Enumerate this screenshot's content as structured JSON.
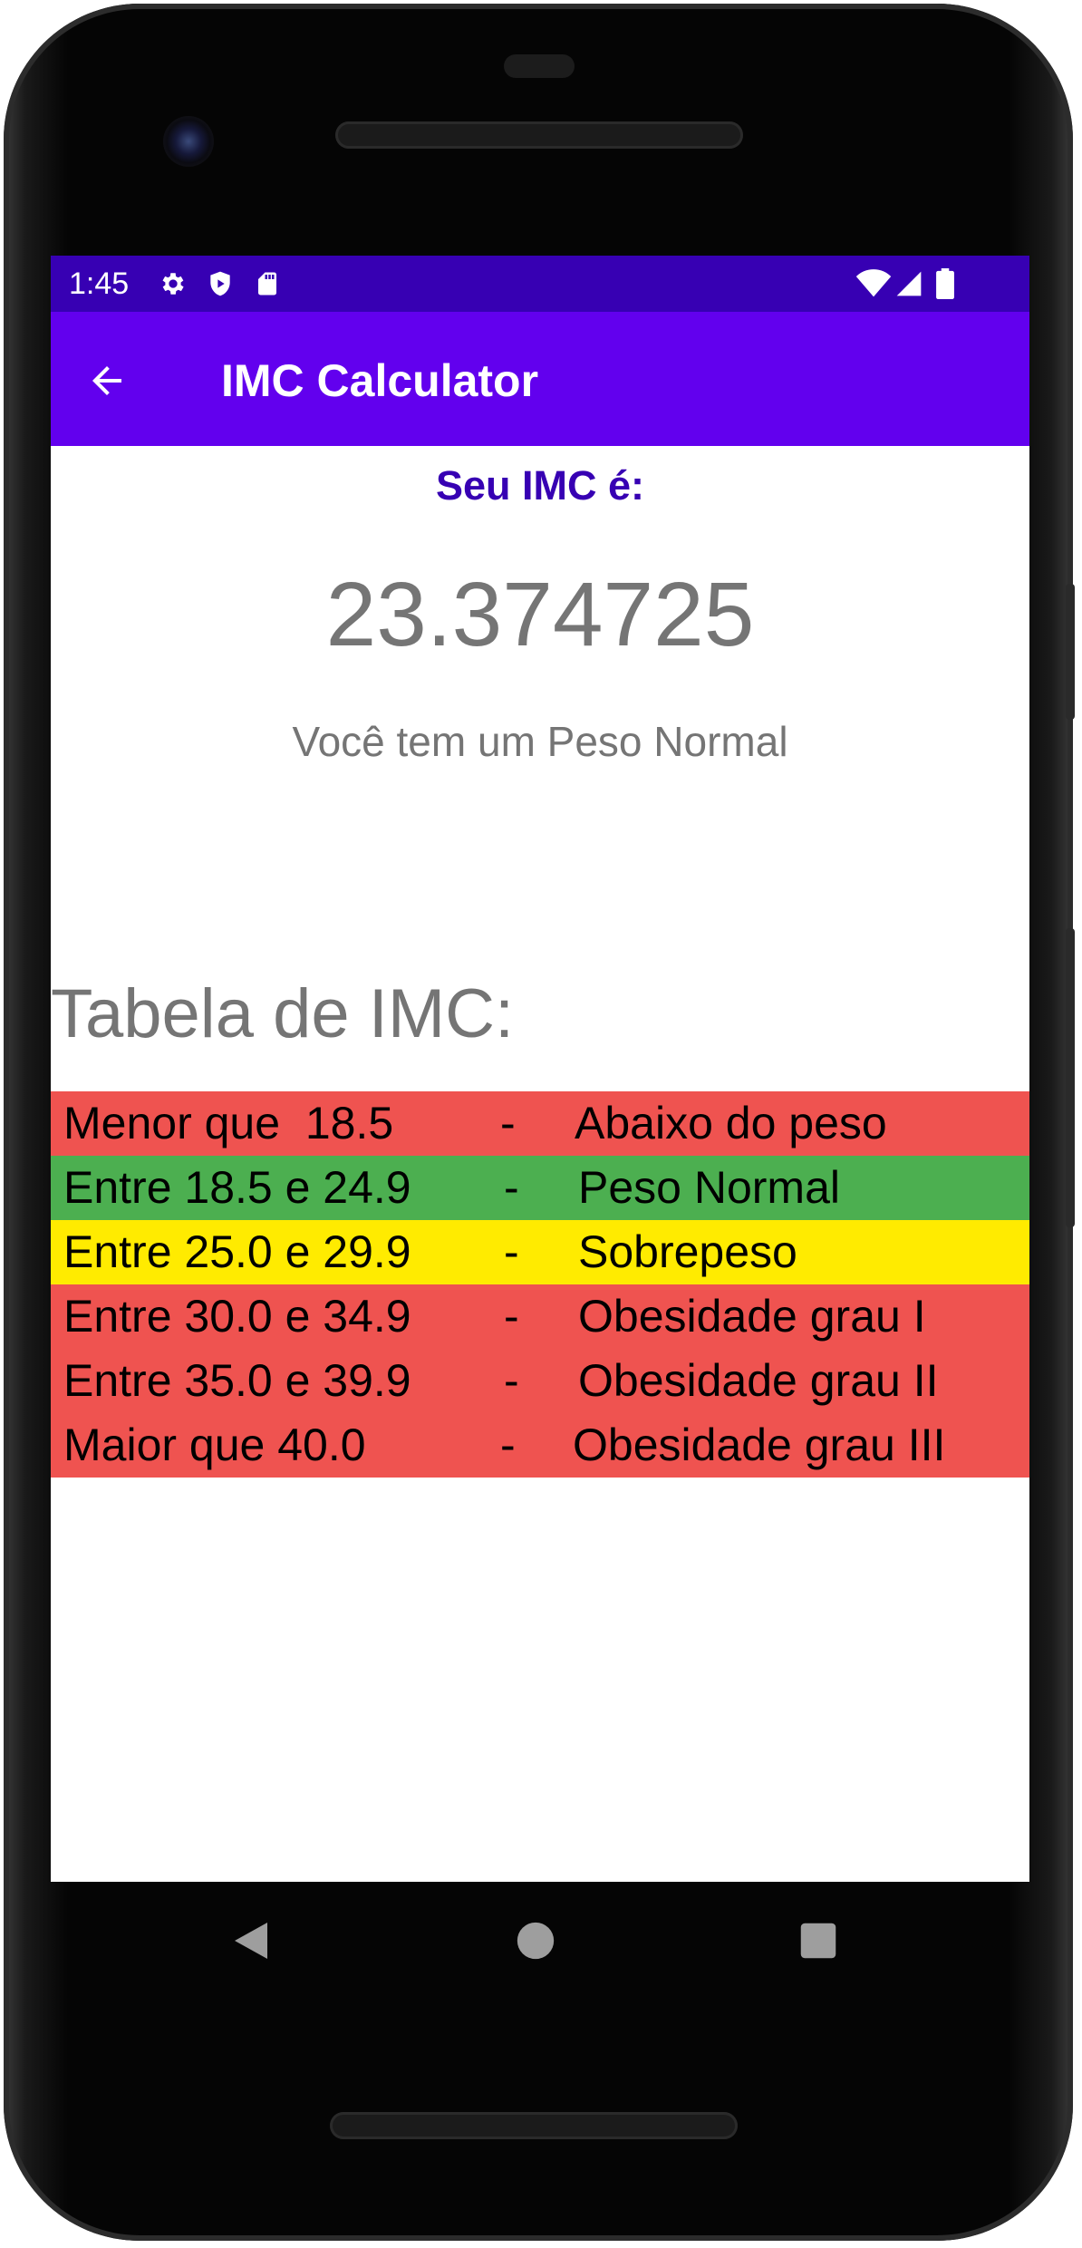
{
  "status_bar": {
    "time": "1:45",
    "icons": [
      "gear-icon",
      "shield-play-icon",
      "sd-card-icon",
      "wifi-icon",
      "signal-icon",
      "battery-icon"
    ],
    "background": "#3700b3"
  },
  "app_bar": {
    "title": "IMC Calculator",
    "back_icon": "arrow-left-icon",
    "background": "#6200ee"
  },
  "result": {
    "label": "Seu IMC é:",
    "value": "23.374725",
    "message": "Você tem um Peso Normal"
  },
  "table": {
    "title": "Tabela de IMC:",
    "rows": [
      {
        "range": "Menor que  18.5",
        "separator": "-",
        "classification": "Abaixo do peso",
        "color": "#ef5350"
      },
      {
        "range": "Entre 18.5 e 24.9",
        "separator": "-",
        "classification": "Peso Normal",
        "color": "#4caf50"
      },
      {
        "range": "Entre 25.0 e 29.9",
        "separator": "-",
        "classification": "Sobrepeso",
        "color": "#ffeb00"
      },
      {
        "range": "Entre 30.0 e 34.9",
        "separator": "-",
        "classification": "Obesidade grau I",
        "color": "#ef5350"
      },
      {
        "range": "Entre 35.0 e 39.9",
        "separator": "-",
        "classification": "Obesidade grau II",
        "color": "#ef5350"
      },
      {
        "range": "Maior que 40.0",
        "separator": "-",
        "classification": "Obesidade grau III",
        "color": "#ef5350"
      }
    ]
  },
  "nav_bar": {
    "buttons": [
      "back-triangle-icon",
      "home-circle-icon",
      "recents-square-icon"
    ]
  }
}
